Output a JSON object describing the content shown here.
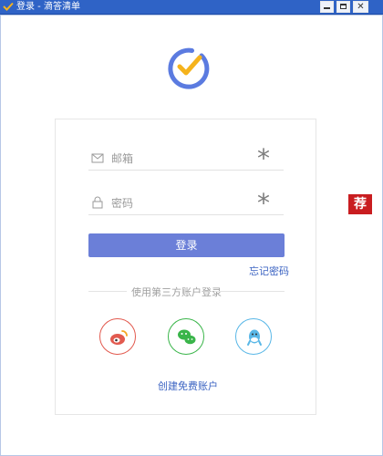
{
  "window": {
    "title": "登录 - 滴答清单",
    "controls": [
      "minimize",
      "maximize",
      "close"
    ]
  },
  "brand": {
    "logo": "check-circle-logo",
    "logo_color": "#5b7be0",
    "check_color": "#f5b31c"
  },
  "form": {
    "email_placeholder": "邮箱",
    "password_placeholder": "密码",
    "required_mark": "*",
    "login_label": "登录",
    "forgot_label": "忘记密码",
    "accent": "#6b7fd8"
  },
  "third_party": {
    "label": "使用第三方账户登录",
    "providers": [
      {
        "name": "weibo",
        "icon": "weibo-icon",
        "color": "#e25a4f"
      },
      {
        "name": "wechat",
        "icon": "wechat-icon",
        "color": "#3ab54a"
      },
      {
        "name": "qq",
        "icon": "qq-icon",
        "color": "#59b7e7"
      }
    ]
  },
  "create_account_label": "创建免费账户",
  "side_badge": {
    "label": "荐",
    "color": "#c91d20"
  }
}
